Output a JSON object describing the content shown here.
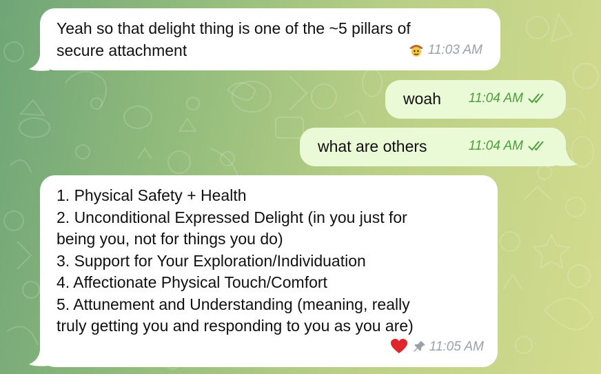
{
  "colors": {
    "background_start": "#6fa577",
    "background_end": "#d4dc8e",
    "incoming_bubble": "#ffffff",
    "outgoing_bubble": "#eaf9d6",
    "outgoing_meta": "#4aa03a",
    "incoming_meta": "#9aa1a8",
    "reaction_heart": "#e0262c"
  },
  "messages": [
    {
      "direction": "incoming",
      "lines": [
        "Yeah so that delight thing is one of the ~5 pillars of",
        "secure attachment"
      ],
      "time": "11:03 AM",
      "reaction_icon": "cowboy-face-emoji"
    },
    {
      "direction": "outgoing",
      "text": "woah",
      "time": "11:04 AM",
      "status_icon": "double-check-icon"
    },
    {
      "direction": "outgoing",
      "text": "what are others",
      "time": "11:04 AM",
      "status_icon": "double-check-icon"
    },
    {
      "direction": "incoming",
      "lines": [
        "1. Physical Safety + Health",
        "2. Unconditional Expressed Delight (in you just for",
        "being you, not for things you do)",
        "3. Support for Your Exploration/Individuation",
        "4. Affectionate Physical Touch/Comfort",
        "5. Attunement and Understanding (meaning, really",
        "truly getting you and responding to you as you are)"
      ],
      "time": "11:05 AM",
      "reaction_icon": "red-heart-icon",
      "pinned_icon": "pin-icon"
    }
  ]
}
